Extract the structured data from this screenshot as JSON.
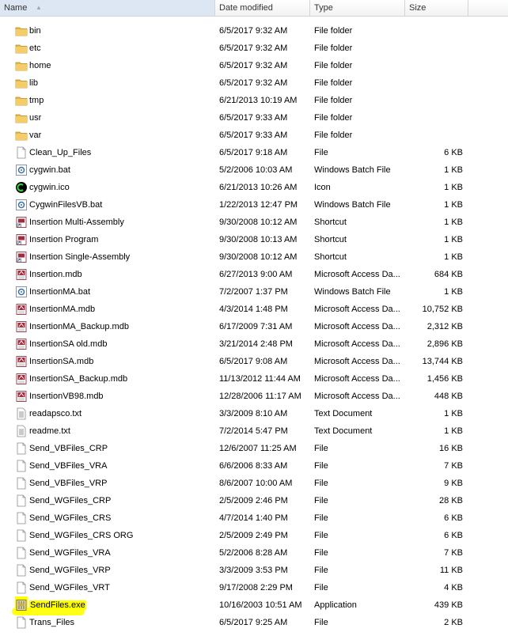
{
  "header": {
    "columns": [
      {
        "label": "Name"
      },
      {
        "label": "Date modified"
      },
      {
        "label": "Type"
      },
      {
        "label": "Size"
      }
    ]
  },
  "files": [
    {
      "name": "bin",
      "date": "6/5/2017 9:32 AM",
      "type": "File folder",
      "size": "",
      "icon": "folder-icon"
    },
    {
      "name": "etc",
      "date": "6/5/2017 9:32 AM",
      "type": "File folder",
      "size": "",
      "icon": "folder-icon"
    },
    {
      "name": "home",
      "date": "6/5/2017 9:32 AM",
      "type": "File folder",
      "size": "",
      "icon": "folder-icon"
    },
    {
      "name": "lib",
      "date": "6/5/2017 9:32 AM",
      "type": "File folder",
      "size": "",
      "icon": "folder-icon"
    },
    {
      "name": "tmp",
      "date": "6/21/2013 10:19 AM",
      "type": "File folder",
      "size": "",
      "icon": "folder-icon"
    },
    {
      "name": "usr",
      "date": "6/5/2017 9:33 AM",
      "type": "File folder",
      "size": "",
      "icon": "folder-icon"
    },
    {
      "name": "var",
      "date": "6/5/2017 9:33 AM",
      "type": "File folder",
      "size": "",
      "icon": "folder-icon"
    },
    {
      "name": "Clean_Up_Files",
      "date": "6/5/2017 9:18 AM",
      "type": "File",
      "size": "6 KB",
      "icon": "file-icon"
    },
    {
      "name": "cygwin.bat",
      "date": "5/2/2006 10:03 AM",
      "type": "Windows Batch File",
      "size": "1 KB",
      "icon": "batch-file-icon"
    },
    {
      "name": "cygwin.ico",
      "date": "6/21/2013 10:26 AM",
      "type": "Icon",
      "size": "1 KB",
      "icon": "cygwin-icon"
    },
    {
      "name": "CygwinFilesVB.bat",
      "date": "1/22/2013 12:47 PM",
      "type": "Windows Batch File",
      "size": "1 KB",
      "icon": "batch-file-icon"
    },
    {
      "name": "Insertion Multi-Assembly",
      "date": "9/30/2008 10:12 AM",
      "type": "Shortcut",
      "size": "1 KB",
      "icon": "shortcut-icon"
    },
    {
      "name": "Insertion Program",
      "date": "9/30/2008 10:13 AM",
      "type": "Shortcut",
      "size": "1 KB",
      "icon": "shortcut-icon"
    },
    {
      "name": "Insertion Single-Assembly",
      "date": "9/30/2008 10:12 AM",
      "type": "Shortcut",
      "size": "1 KB",
      "icon": "shortcut-icon"
    },
    {
      "name": "Insertion.mdb",
      "date": "6/27/2013 9:00 AM",
      "type": "Microsoft Access Da...",
      "size": "684 KB",
      "icon": "access-db-icon"
    },
    {
      "name": "InsertionMA.bat",
      "date": "7/2/2007 1:37 PM",
      "type": "Windows Batch File",
      "size": "1 KB",
      "icon": "batch-file-icon"
    },
    {
      "name": "InsertionMA.mdb",
      "date": "4/3/2014 1:48 PM",
      "type": "Microsoft Access Da...",
      "size": "10,752 KB",
      "icon": "access-db-icon"
    },
    {
      "name": "InsertionMA_Backup.mdb",
      "date": "6/17/2009 7:31 AM",
      "type": "Microsoft Access Da...",
      "size": "2,312 KB",
      "icon": "access-db-icon"
    },
    {
      "name": "InsertionSA old.mdb",
      "date": "3/21/2014 2:48 PM",
      "type": "Microsoft Access Da...",
      "size": "2,896 KB",
      "icon": "access-db-icon"
    },
    {
      "name": "InsertionSA.mdb",
      "date": "6/5/2017 9:08 AM",
      "type": "Microsoft Access Da...",
      "size": "13,744 KB",
      "icon": "access-db-icon"
    },
    {
      "name": "InsertionSA_Backup.mdb",
      "date": "11/13/2012 11:44 AM",
      "type": "Microsoft Access Da...",
      "size": "1,456 KB",
      "icon": "access-db-icon"
    },
    {
      "name": "InsertionVB98.mdb",
      "date": "12/28/2006 11:17 AM",
      "type": "Microsoft Access Da...",
      "size": "448 KB",
      "icon": "access-db-icon"
    },
    {
      "name": "readapsco.txt",
      "date": "3/3/2009 8:10 AM",
      "type": "Text Document",
      "size": "1 KB",
      "icon": "text-file-icon"
    },
    {
      "name": "readme.txt",
      "date": "7/2/2014 5:47 PM",
      "type": "Text Document",
      "size": "1 KB",
      "icon": "text-file-icon"
    },
    {
      "name": "Send_VBFiles_CRP",
      "date": "12/6/2007 11:25 AM",
      "type": "File",
      "size": "16 KB",
      "icon": "file-icon"
    },
    {
      "name": "Send_VBFiles_VRA",
      "date": "6/6/2006 8:33 AM",
      "type": "File",
      "size": "7 KB",
      "icon": "file-icon"
    },
    {
      "name": "Send_VBFiles_VRP",
      "date": "8/6/2007 10:00 AM",
      "type": "File",
      "size": "9 KB",
      "icon": "file-icon"
    },
    {
      "name": "Send_WGFiles_CRP",
      "date": "2/5/2009 2:46 PM",
      "type": "File",
      "size": "28 KB",
      "icon": "file-icon"
    },
    {
      "name": "Send_WGFiles_CRS",
      "date": "4/7/2014 1:40 PM",
      "type": "File",
      "size": "6 KB",
      "icon": "file-icon"
    },
    {
      "name": "Send_WGFiles_CRS ORG",
      "date": "2/5/2009 2:49 PM",
      "type": "File",
      "size": "6 KB",
      "icon": "file-icon"
    },
    {
      "name": "Send_WGFiles_VRA",
      "date": "5/2/2006 8:28 AM",
      "type": "File",
      "size": "7 KB",
      "icon": "file-icon"
    },
    {
      "name": "Send_WGFiles_VRP",
      "date": "3/3/2009 3:53 PM",
      "type": "File",
      "size": "11 KB",
      "icon": "file-icon"
    },
    {
      "name": "Send_WGFiles_VRT",
      "date": "9/17/2008 2:29 PM",
      "type": "File",
      "size": "4 KB",
      "icon": "file-icon"
    },
    {
      "name": "SendFiles.exe",
      "date": "10/16/2003 10:51 AM",
      "type": "Application",
      "size": "439 KB",
      "icon": "application-icon",
      "highlighted": true
    },
    {
      "name": "Trans_Files",
      "date": "6/5/2017 9:25 AM",
      "type": "File",
      "size": "2 KB",
      "icon": "file-icon"
    }
  ],
  "colors": {
    "highlight": "#ffff00",
    "folder": "#e8b84a",
    "header_bg": "#f1f2f4"
  }
}
